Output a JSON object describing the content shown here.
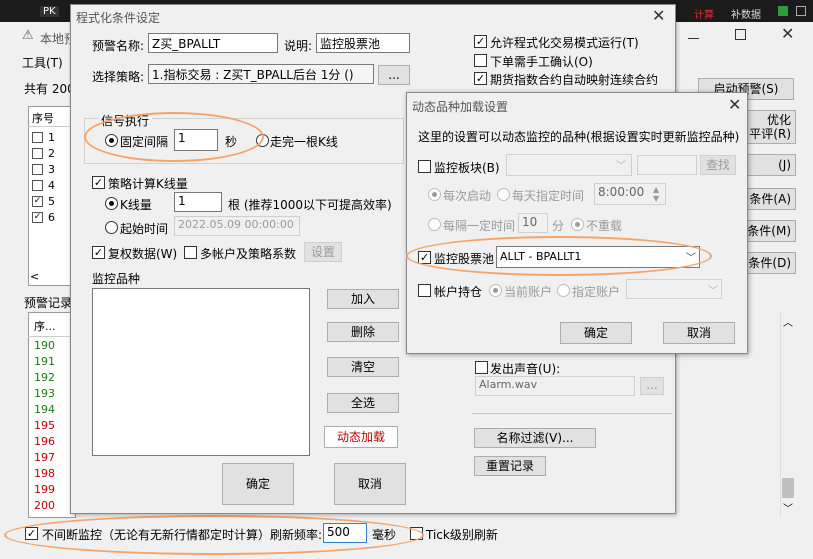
{
  "bg_window": {
    "top_bar_left": "PK",
    "top_bar_right_1": "计算",
    "top_bar_right_2": "补数据",
    "title": "本地预",
    "tools_menu": "工具(T)",
    "total_label": "共有 200",
    "table_header_seq": "序号",
    "row_numbers": [
      "1",
      "2",
      "3",
      "4",
      "5",
      "6"
    ],
    "row_checked": [
      false,
      false,
      false,
      false,
      true,
      true
    ],
    "log_label": "预警记录",
    "log_header_seq": "序...",
    "log_numbers": [
      "190",
      "191",
      "192",
      "193",
      "194",
      "195",
      "196",
      "197",
      "198",
      "199",
      "200"
    ],
    "log_colors": [
      "#1a7a1a",
      "#1a7a1a",
      "#1a7a1a",
      "#1a7a1a",
      "#1a7a1a",
      "#c00000",
      "#c00000",
      "#c00000",
      "#c00000",
      "#c00000",
      "#c00000"
    ],
    "right_btn_start": "启动预警(S)",
    "right_btn_optimize": "优化\n平评(R)",
    "right_btn_j": "(J)",
    "right_btn_cond_a": "条件(A)",
    "right_btn_cond_m": "条件(M)",
    "right_btn_cond_d": "条件(D)",
    "bottom_uninterrupted": "不间断监控（无论有无新行情都定时计算）刷新频率:",
    "refresh_value": "500",
    "ms_label": "毫秒",
    "tick_refresh": "Tick级别刷新"
  },
  "main_dialog": {
    "title": "程式化条件设定",
    "alert_name_label": "预警名称:",
    "alert_name_value": "Z买_BPALLT",
    "desc_label": "说明:",
    "desc_value": "监控股票池",
    "strategy_label": "选择策略:",
    "strategy_value": "1.指标交易 : Z买T_BPALL后台 1分 ()",
    "browse_button": "...",
    "allow_program": "允许程式化交易模式运行(T)",
    "manual_confirm": "下单需手工确认(O)",
    "futures_index_map": "期货指数合约自动映射连续合约",
    "signal_group": "信号执行",
    "fixed_interval": "固定间隔",
    "interval_value": "1",
    "seconds_unit": "秒",
    "after_k_line": "走完一根K线",
    "strategy_calc_k": "策略计算K线量",
    "k_line_count_label": "K线量",
    "k_line_count_value": "1",
    "k_line_hint": "根 (推荐1000以下可提高效率)",
    "start_time_label": "起始时间",
    "start_time_value": "2022.05.09 00:00:00",
    "restore_data": "复权数据(W)",
    "multi_account": "多帐户及策略系数",
    "settings_button": "设置",
    "monitor_products": "监控品种",
    "add_button": "加入",
    "delete_button": "删除",
    "clear_button": "清空",
    "select_all_button": "全选",
    "dynamic_load_button": "动态加载",
    "sound_label": "发出声音(U):",
    "sound_file": "Alarm.wav",
    "name_filter_button": "名称过滤(V)...",
    "reset_record_button": "重置记录",
    "ok_button": "确定",
    "cancel_button": "取消"
  },
  "sub_dialog": {
    "title": "动态品种加载设置",
    "description": "这里的设置可以动态监控的品种(根据设置实时更新监控品种)",
    "monitor_sector": "监控板块(B)",
    "find_button": "查找",
    "each_start": "每次启动",
    "daily_time": "每天指定时间",
    "daily_time_value": "8:00:00",
    "every_interval": "每隔一定时间",
    "interval_value": "10",
    "minutes_unit": "分",
    "no_reload": "不重载",
    "monitor_pool": "监控股票池",
    "pool_value": "ALLT - BPALLT1",
    "account_holdings": "帐户持仓",
    "current_account": "当前账户",
    "specified_account": "指定账户",
    "ok_button": "确定",
    "cancel_button": "取消"
  }
}
